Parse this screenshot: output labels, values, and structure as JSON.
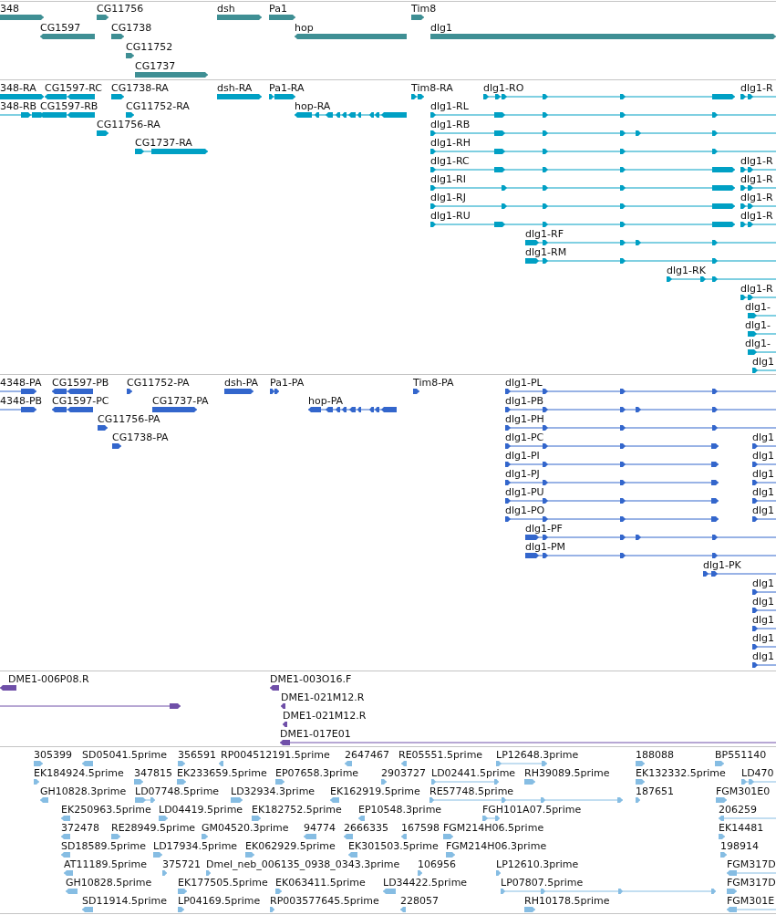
{
  "tracks": [
    {
      "kind": "gene",
      "features": [
        {
          "label": "348",
          "reverse": false
        },
        {
          "label": "CG11756",
          "reverse": false
        },
        {
          "label": "dsh",
          "reverse": false
        },
        {
          "label": "Pa1",
          "reverse": false
        },
        {
          "label": "Tim8",
          "reverse": false
        },
        {
          "label": "CG1597",
          "reverse": true
        },
        {
          "label": "CG1738",
          "reverse": false
        },
        {
          "label": "hop",
          "reverse": true
        },
        {
          "label": "dlg1",
          "reverse": false
        },
        {
          "label": "CG11752",
          "reverse": false
        },
        {
          "label": "CG1737",
          "reverse": false
        }
      ]
    },
    {
      "kind": "transcript",
      "features": [
        {
          "label": "348-RA",
          "reverse": false
        },
        {
          "label": "CG1597-RC",
          "reverse": true
        },
        {
          "label": "CG1738-RA",
          "reverse": false
        },
        {
          "label": "dsh-RA",
          "reverse": false
        },
        {
          "label": "Pa1-RA",
          "reverse": false
        },
        {
          "label": "Tim8-RA",
          "reverse": false
        },
        {
          "label": "dlg1-RO",
          "reverse": false
        },
        {
          "label": "dlg1-R",
          "reverse": false
        },
        {
          "label": "348-RB",
          "reverse": false
        },
        {
          "label": "CG1597-RB",
          "reverse": true
        },
        {
          "label": "CG11752-RA",
          "reverse": false
        },
        {
          "label": "hop-RA",
          "reverse": true
        },
        {
          "label": "dlg1-RL",
          "reverse": false
        },
        {
          "label": "CG11756-RA",
          "reverse": false
        },
        {
          "label": "dlg1-RB",
          "reverse": false
        },
        {
          "label": "CG1737-RA",
          "reverse": false
        },
        {
          "label": "dlg1-RH",
          "reverse": false
        },
        {
          "label": "dlg1-RC",
          "reverse": false
        },
        {
          "label": "dlg1-R",
          "reverse": false
        },
        {
          "label": "dlg1-RI",
          "reverse": false
        },
        {
          "label": "dlg1-R",
          "reverse": false
        },
        {
          "label": "dlg1-RJ",
          "reverse": false
        },
        {
          "label": "dlg1-R",
          "reverse": false
        },
        {
          "label": "dlg1-RU",
          "reverse": false
        },
        {
          "label": "dlg1-R",
          "reverse": false
        },
        {
          "label": "dlg1-RF",
          "reverse": false
        },
        {
          "label": "dlg1-RM",
          "reverse": false
        },
        {
          "label": "dlg1-RK",
          "reverse": false
        },
        {
          "label": "dlg1-R",
          "reverse": false
        },
        {
          "label": "dlg1-",
          "reverse": false
        },
        {
          "label": "dlg1-",
          "reverse": false
        },
        {
          "label": "dlg1-",
          "reverse": false
        },
        {
          "label": "dlg1",
          "reverse": false
        }
      ]
    },
    {
      "kind": "protein",
      "features": [
        {
          "label": "4348-PA",
          "reverse": false
        },
        {
          "label": "CG1597-PB",
          "reverse": true
        },
        {
          "label": "CG11752-PA",
          "reverse": false
        },
        {
          "label": "dsh-PA",
          "reverse": false
        },
        {
          "label": "Pa1-PA",
          "reverse": false
        },
        {
          "label": "Tim8-PA",
          "reverse": false
        },
        {
          "label": "dlg1-PL",
          "reverse": false
        },
        {
          "label": "4348-PB",
          "reverse": false
        },
        {
          "label": "CG1597-PC",
          "reverse": true
        },
        {
          "label": "CG1737-PA",
          "reverse": false
        },
        {
          "label": "hop-PA",
          "reverse": true
        },
        {
          "label": "dlg1-PB",
          "reverse": false
        },
        {
          "label": "CG11756-PA",
          "reverse": false
        },
        {
          "label": "dlg1-PH",
          "reverse": false
        },
        {
          "label": "CG1738-PA",
          "reverse": false
        },
        {
          "label": "dlg1-PC",
          "reverse": false
        },
        {
          "label": "dlg1",
          "reverse": false
        },
        {
          "label": "dlg1-PI",
          "reverse": false
        },
        {
          "label": "dlg1",
          "reverse": false
        },
        {
          "label": "dlg1-PJ",
          "reverse": false
        },
        {
          "label": "dlg1",
          "reverse": false
        },
        {
          "label": "dlg1-PU",
          "reverse": false
        },
        {
          "label": "dlg1",
          "reverse": false
        },
        {
          "label": "dlg1-PO",
          "reverse": false
        },
        {
          "label": "dlg1",
          "reverse": false
        },
        {
          "label": "dlg1-PF",
          "reverse": false
        },
        {
          "label": "dlg1-PM",
          "reverse": false
        },
        {
          "label": "dlg1-PK",
          "reverse": false
        },
        {
          "label": "dlg1",
          "reverse": false
        },
        {
          "label": "dlg1",
          "reverse": false
        },
        {
          "label": "dlg1",
          "reverse": false
        },
        {
          "label": "dlg1",
          "reverse": false
        },
        {
          "label": "dlg1",
          "reverse": false
        }
      ]
    },
    {
      "kind": "clone",
      "features": [
        {
          "label": "DME1-006P08.R",
          "reverse": true
        },
        {
          "label": "DME1-003O16.F",
          "reverse": true
        },
        {
          "reverse": false
        },
        {
          "label": "DME1-021M12.R",
          "reverse": true
        },
        {
          "label": "DME1-021M12.R",
          "reverse": true
        },
        {
          "label": "DME1-017E01",
          "reverse": true
        }
      ]
    },
    {
      "kind": "est",
      "features": [
        {
          "label": "305399",
          "reverse": false
        },
        {
          "label": "SD05041.5prime",
          "reverse": true
        },
        {
          "label": "356591",
          "reverse": false
        },
        {
          "label": "RP004512191.5prime",
          "reverse": true
        },
        {
          "label": "2647467",
          "reverse": true
        },
        {
          "label": "RE05551.5prime",
          "reverse": true
        },
        {
          "label": "LP12648.3prime",
          "reverse": false
        },
        {
          "label": "188088",
          "reverse": false
        },
        {
          "label": "BP551140",
          "reverse": false
        },
        {
          "label": "EK184924.5prime",
          "reverse": false
        },
        {
          "label": "347815",
          "reverse": false
        },
        {
          "label": "EK233659.5prime",
          "reverse": false
        },
        {
          "label": "EP07658.3prime",
          "reverse": false
        },
        {
          "label": "2903727",
          "reverse": false
        },
        {
          "label": "LD02441.5prime",
          "reverse": false
        },
        {
          "label": "RH39089.5prime",
          "reverse": false
        },
        {
          "label": "EK132332.5prime",
          "reverse": false
        },
        {
          "label": "LD470",
          "reverse": false
        },
        {
          "label": "GH10828.3prime",
          "reverse": true
        },
        {
          "label": "LD07748.5prime",
          "reverse": false
        },
        {
          "label": "LD32934.3prime",
          "reverse": false
        },
        {
          "label": "EK162919.5prime",
          "reverse": true
        },
        {
          "label": "RE57748.5prime",
          "reverse": false
        },
        {
          "label": "187651",
          "reverse": false
        },
        {
          "label": "FGM301E0",
          "reverse": false
        },
        {
          "label": "EK250963.5prime",
          "reverse": true
        },
        {
          "label": "LD04419.5prime",
          "reverse": false
        },
        {
          "label": "EK182752.5prime",
          "reverse": false
        },
        {
          "label": "EP10548.3prime",
          "reverse": true
        },
        {
          "label": "FGH101A07.5prime",
          "reverse": false
        },
        {
          "label": "206259",
          "reverse": true
        },
        {
          "label": "372478",
          "reverse": true
        },
        {
          "label": "RE28949.5prime",
          "reverse": false
        },
        {
          "label": "GM04520.3prime",
          "reverse": false
        },
        {
          "label": "94774",
          "reverse": true
        },
        {
          "label": "2666335",
          "reverse": true
        },
        {
          "label": "167598",
          "reverse": true
        },
        {
          "label": "FGM214H06.5prime",
          "reverse": false
        },
        {
          "label": "EK14481",
          "reverse": false
        },
        {
          "label": "SD18589.5prime",
          "reverse": true
        },
        {
          "label": "LD17934.5prime",
          "reverse": false
        },
        {
          "label": "EK062929.5prime",
          "reverse": false
        },
        {
          "label": "EK301503.5prime",
          "reverse": true
        },
        {
          "label": "FGM214H06.3prime",
          "reverse": false
        },
        {
          "label": "198914",
          "reverse": false
        },
        {
          "label": "AT11189.5prime",
          "reverse": true
        },
        {
          "label": "375721",
          "reverse": false
        },
        {
          "label": "Dmel_neb_006135_0938_0343.3prime",
          "reverse": false
        },
        {
          "label": "106956",
          "reverse": false
        },
        {
          "label": "LP12610.3prime",
          "reverse": false
        },
        {
          "label": "FGM317D",
          "reverse": true
        },
        {
          "label": "GH10828.5prime",
          "reverse": true
        },
        {
          "label": "EK177505.5prime",
          "reverse": false
        },
        {
          "label": "EK063411.5prime",
          "reverse": false
        },
        {
          "label": "LD34422.5prime",
          "reverse": true
        },
        {
          "label": "LP07807.5prime",
          "reverse": false
        },
        {
          "label": "FGM317D",
          "reverse": false
        },
        {
          "label": "SD11914.5prime",
          "reverse": true
        },
        {
          "label": "LP04169.5prime",
          "reverse": false
        },
        {
          "label": "RP003577645.5prime",
          "reverse": false
        },
        {
          "label": "228057",
          "reverse": true
        },
        {
          "label": "RH10178.5prime",
          "reverse": false
        },
        {
          "label": "FGM301E",
          "reverse": true
        }
      ]
    }
  ]
}
